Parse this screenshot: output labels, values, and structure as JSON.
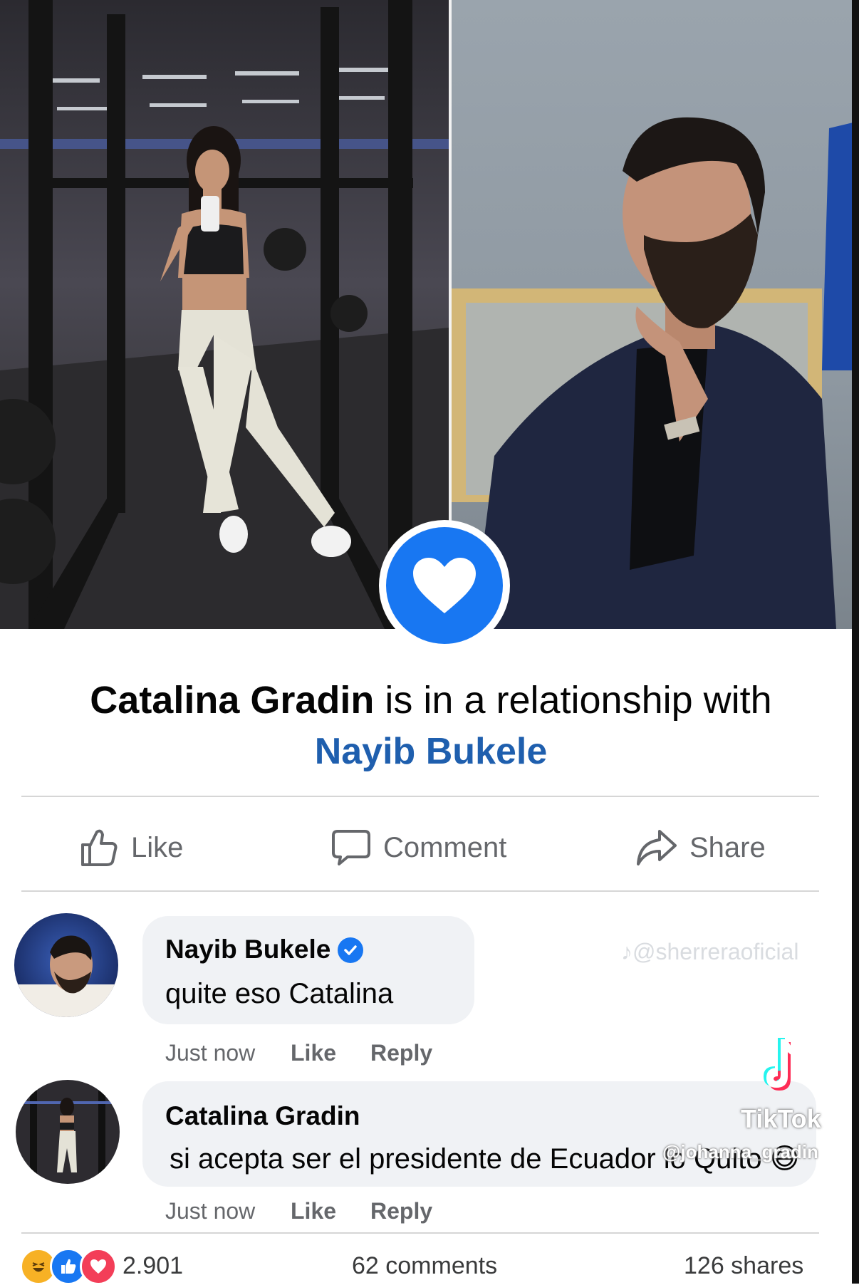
{
  "relationship": {
    "person": "Catalina Gradin",
    "phrase": "is in a relationship with",
    "partner": "Nayib Bukele"
  },
  "actions": {
    "like": "Like",
    "comment": "Comment",
    "share": "Share"
  },
  "comments": [
    {
      "author": "Nayib Bukele",
      "verified": true,
      "text": "quite eso Catalina",
      "time": "Just now",
      "like": "Like",
      "reply": "Reply"
    },
    {
      "author": "Catalina Gradin",
      "verified": false,
      "text": "si acepta ser el presidente de Ecuador lo Quito",
      "emoji": "😅",
      "time": "Just now",
      "like": "Like",
      "reply": "Reply"
    }
  ],
  "watermarks": {
    "top": "♪@sherreraoficial",
    "brand": "TikTok",
    "user": "@johanna_gradin"
  },
  "footer": {
    "reactions_count": "2.901",
    "comments": "62 comments",
    "shares": "126 shares"
  },
  "colors": {
    "facebook_blue": "#1877f2",
    "link_blue": "#1f5fae",
    "bubble": "#f0f2f5",
    "muted": "#65676b"
  }
}
